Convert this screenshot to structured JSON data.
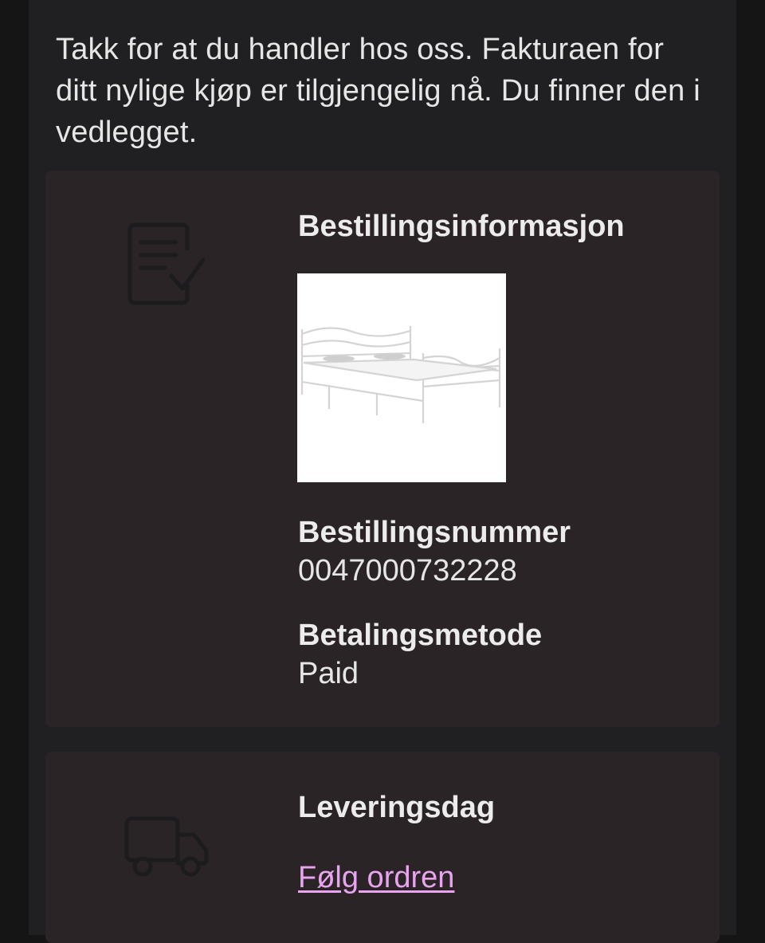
{
  "intro": {
    "text": "Takk for at du handler hos oss. Fakturaen for ditt nylige kjøp er tilgjengelig nå. Du finner den i vedlegget."
  },
  "order_card": {
    "icon": "invoice-check-icon",
    "heading": "Bestillingsinformasjon",
    "product_image": "metal-bed-frame-photo",
    "order_number_label": "Bestillingsnummer",
    "order_number": "0047000732228",
    "payment_method_label": "Betalingsmetode",
    "payment_method": "Paid"
  },
  "delivery_card": {
    "icon": "delivery-truck-icon",
    "heading": "Leveringsdag",
    "track_link": "Følg ordren"
  },
  "colors": {
    "page_background": "#151515",
    "email_background": "#202022",
    "card_background": "#2a2427",
    "text": "#e6e6e6",
    "link": "#e9a4f0",
    "icon": "#1c1b1d"
  }
}
